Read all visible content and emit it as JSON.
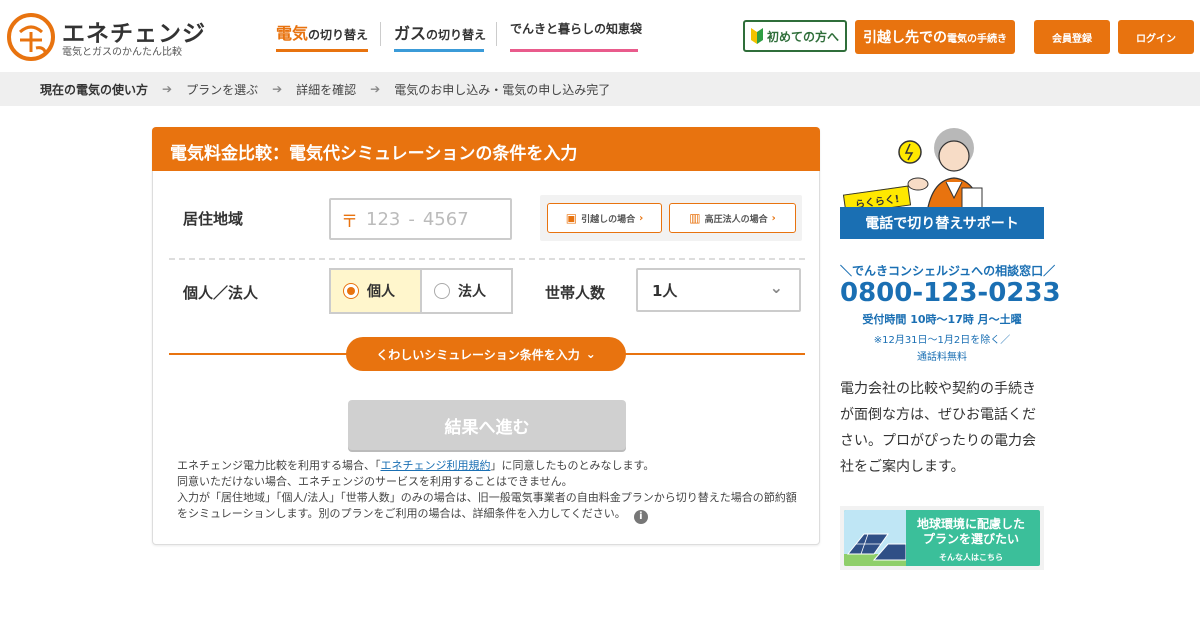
{
  "brand": {
    "name": "エネチェンジ",
    "tagline": "電気とガスのかんたん比較",
    "accent": "#e8730f",
    "blue": "#1a6fb3"
  },
  "nav": {
    "electric": {
      "big": "電気",
      "small": "の切り替え",
      "bar_color": "#e8730f"
    },
    "gas": {
      "big": "ガス",
      "small": "の切り替え",
      "bar_color": "#3b9bd8"
    },
    "tips": {
      "label": "でんきと暮らしの知恵袋",
      "bar_color": "#e95b8c"
    }
  },
  "header_buttons": {
    "first_time": "初めての方へ",
    "move_big": "引越し先での",
    "move_small": "電気の手続き",
    "register": "会員登録",
    "login": "ログイン"
  },
  "breadcrumb": [
    "現在の電気の使い方",
    "プランを選ぶ",
    "詳細を確認",
    "電気のお申し込み・電気の申し込み完了"
  ],
  "form": {
    "title": "電気料金比較：電気代シミュレーションの条件を入力",
    "region_label": "居住地域",
    "zip_mark": "〒",
    "zip_first_placeholder": "123",
    "zip_dash": "-",
    "zip_last_placeholder": "4567",
    "moving_button": "引越しの場合",
    "high_voltage_button": "高圧法人の場合",
    "type_label": "個人／法人",
    "type_options": [
      "個人",
      "法人"
    ],
    "type_selected": "個人",
    "household_label": "世帯人数",
    "household_value": "1人",
    "detail_button": "くわしいシミュレーション条件を入力",
    "submit": "結果へ進む",
    "notes": {
      "line1_pre": "エネチェンジ電力比較を利用する場合、「",
      "line1_link": "エネチェンジ利用規約",
      "line1_post": "」に同意したものとみなします。",
      "line2": "同意いただけない場合、エネチェンジのサービスを利用することはできません。",
      "line3": "入力が「居住地域」「個人/法人」「世帯人数」のみの場合は、旧一般電気事業者の自由料金プランから切り替えた場合の節約額をシミュレーションします。別のプランをご利用の場合は、詳細条件を入力してください。"
    }
  },
  "sidebar": {
    "rakuraku": "らくらく!",
    "support_banner": "電話で切り替えサポート",
    "concierge": "＼でんきコンシェルジュへの相談窓口／",
    "phone": "0800-123-0233",
    "hours": "受付時間 10時〜17時 月〜土曜",
    "holiday": "※12月31日〜1月2日を除く／",
    "fee": "通話料無料",
    "description": "電力会社の比較や契約の手続きが面倒な方は、ぜひお電話ください。プロがぴったりの電力会社をご案内します。",
    "eco_title": "地球環境に配慮した\nプランを選びたい",
    "eco_sub": "そんな人はこちら"
  }
}
